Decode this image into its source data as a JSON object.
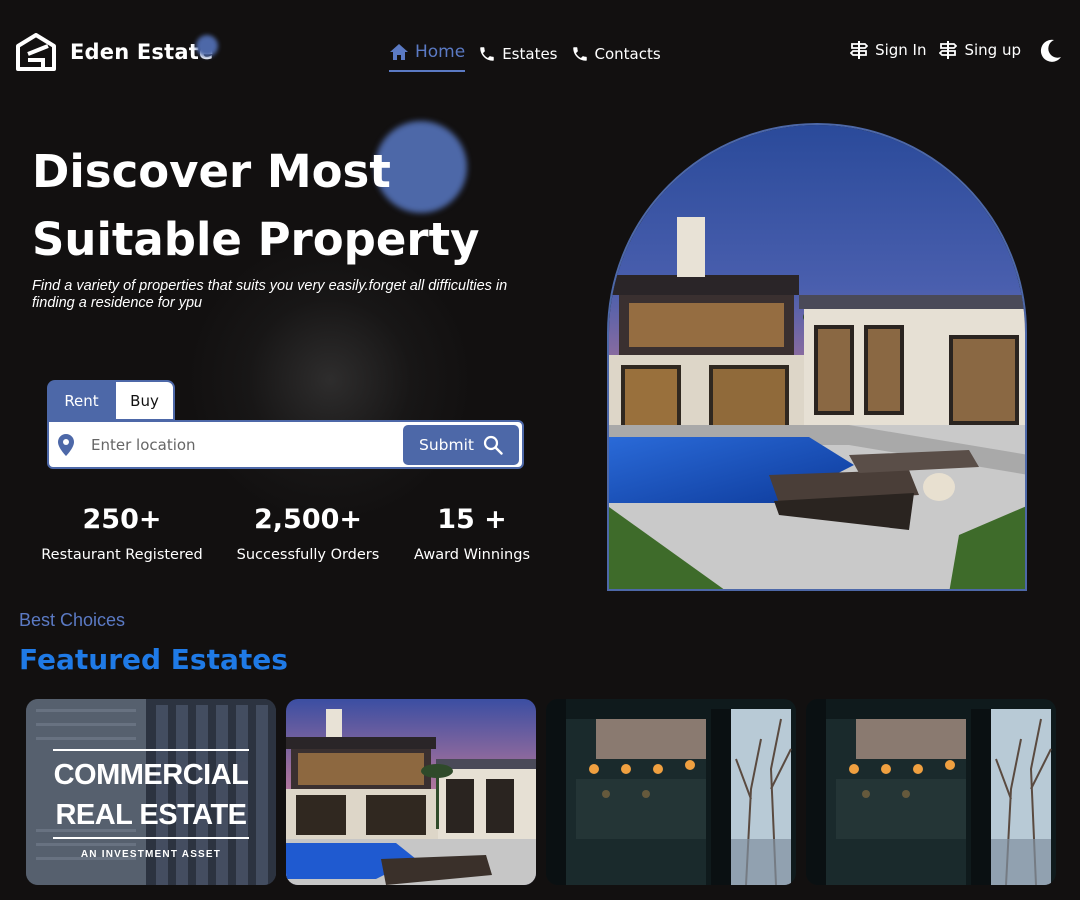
{
  "brand": {
    "name": "Eden Estate",
    "accent": "#4d68a8",
    "link_blue": "#1f7ae6",
    "background": "#121010"
  },
  "nav": {
    "links": [
      {
        "label": "Home",
        "icon": "home-icon",
        "active": true
      },
      {
        "label": "Estates",
        "icon": "phone-icon",
        "active": false
      },
      {
        "label": "Contacts",
        "icon": "phone-icon",
        "active": false
      }
    ],
    "sign_in": "Sign In",
    "sign_up": "Sing up",
    "theme_icon": "moon-icon"
  },
  "hero": {
    "title_line1": "Discover Most",
    "title_line2": "Suitable Property",
    "subtitle": "Find a variety of properties that suits you very easily.forget all difficulties in finding a residence for ypu"
  },
  "search": {
    "tabs": [
      "Rent",
      "Buy"
    ],
    "active_tab": "Rent",
    "placeholder": "Enter location",
    "value": "",
    "submit_label": "Submit"
  },
  "stats": [
    {
      "value": "250+",
      "label": "Restaurant Registered"
    },
    {
      "value": "2,500+",
      "label": "Successfully Orders"
    },
    {
      "value": "15 +",
      "label": "Award Winnings"
    }
  ],
  "featured": {
    "eyebrow": "Best Choices",
    "title": "Featured Estates",
    "cards": [
      {
        "kind": "commercial-poster",
        "line1": "COMMERCIAL",
        "line2": "REAL ESTATE",
        "tagline": "AN INVESTMENT ASSET"
      },
      {
        "kind": "villa-photo"
      },
      {
        "kind": "cafe-photo"
      },
      {
        "kind": "cafe-photo"
      }
    ]
  }
}
